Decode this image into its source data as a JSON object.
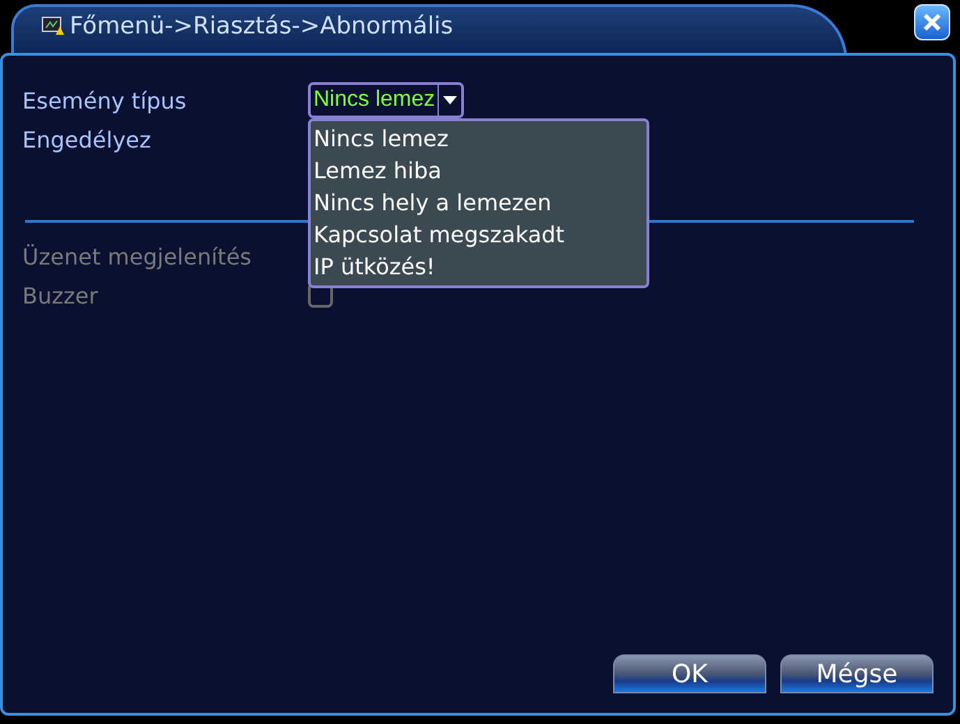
{
  "window": {
    "title": "Főmenü->Riasztás->Abnormális"
  },
  "rows": [
    {
      "label": "Esemény típus",
      "disabled": false
    },
    {
      "label": "Engedélyez",
      "disabled": false
    },
    {
      "label": "Üzenet megjelenítés",
      "disabled": true
    },
    {
      "label": "Buzzer",
      "disabled": true,
      "kind": "checkbox",
      "checked": false
    }
  ],
  "dropdown": {
    "value": "Nincs lemez",
    "expanded": true,
    "options": [
      "Nincs lemez",
      "Lemez hiba",
      "Nincs hely a lemezen",
      "Kapcsolat megszakadt",
      "IP ütközés!"
    ]
  },
  "buttons": [
    "OK",
    "Mégse"
  ]
}
